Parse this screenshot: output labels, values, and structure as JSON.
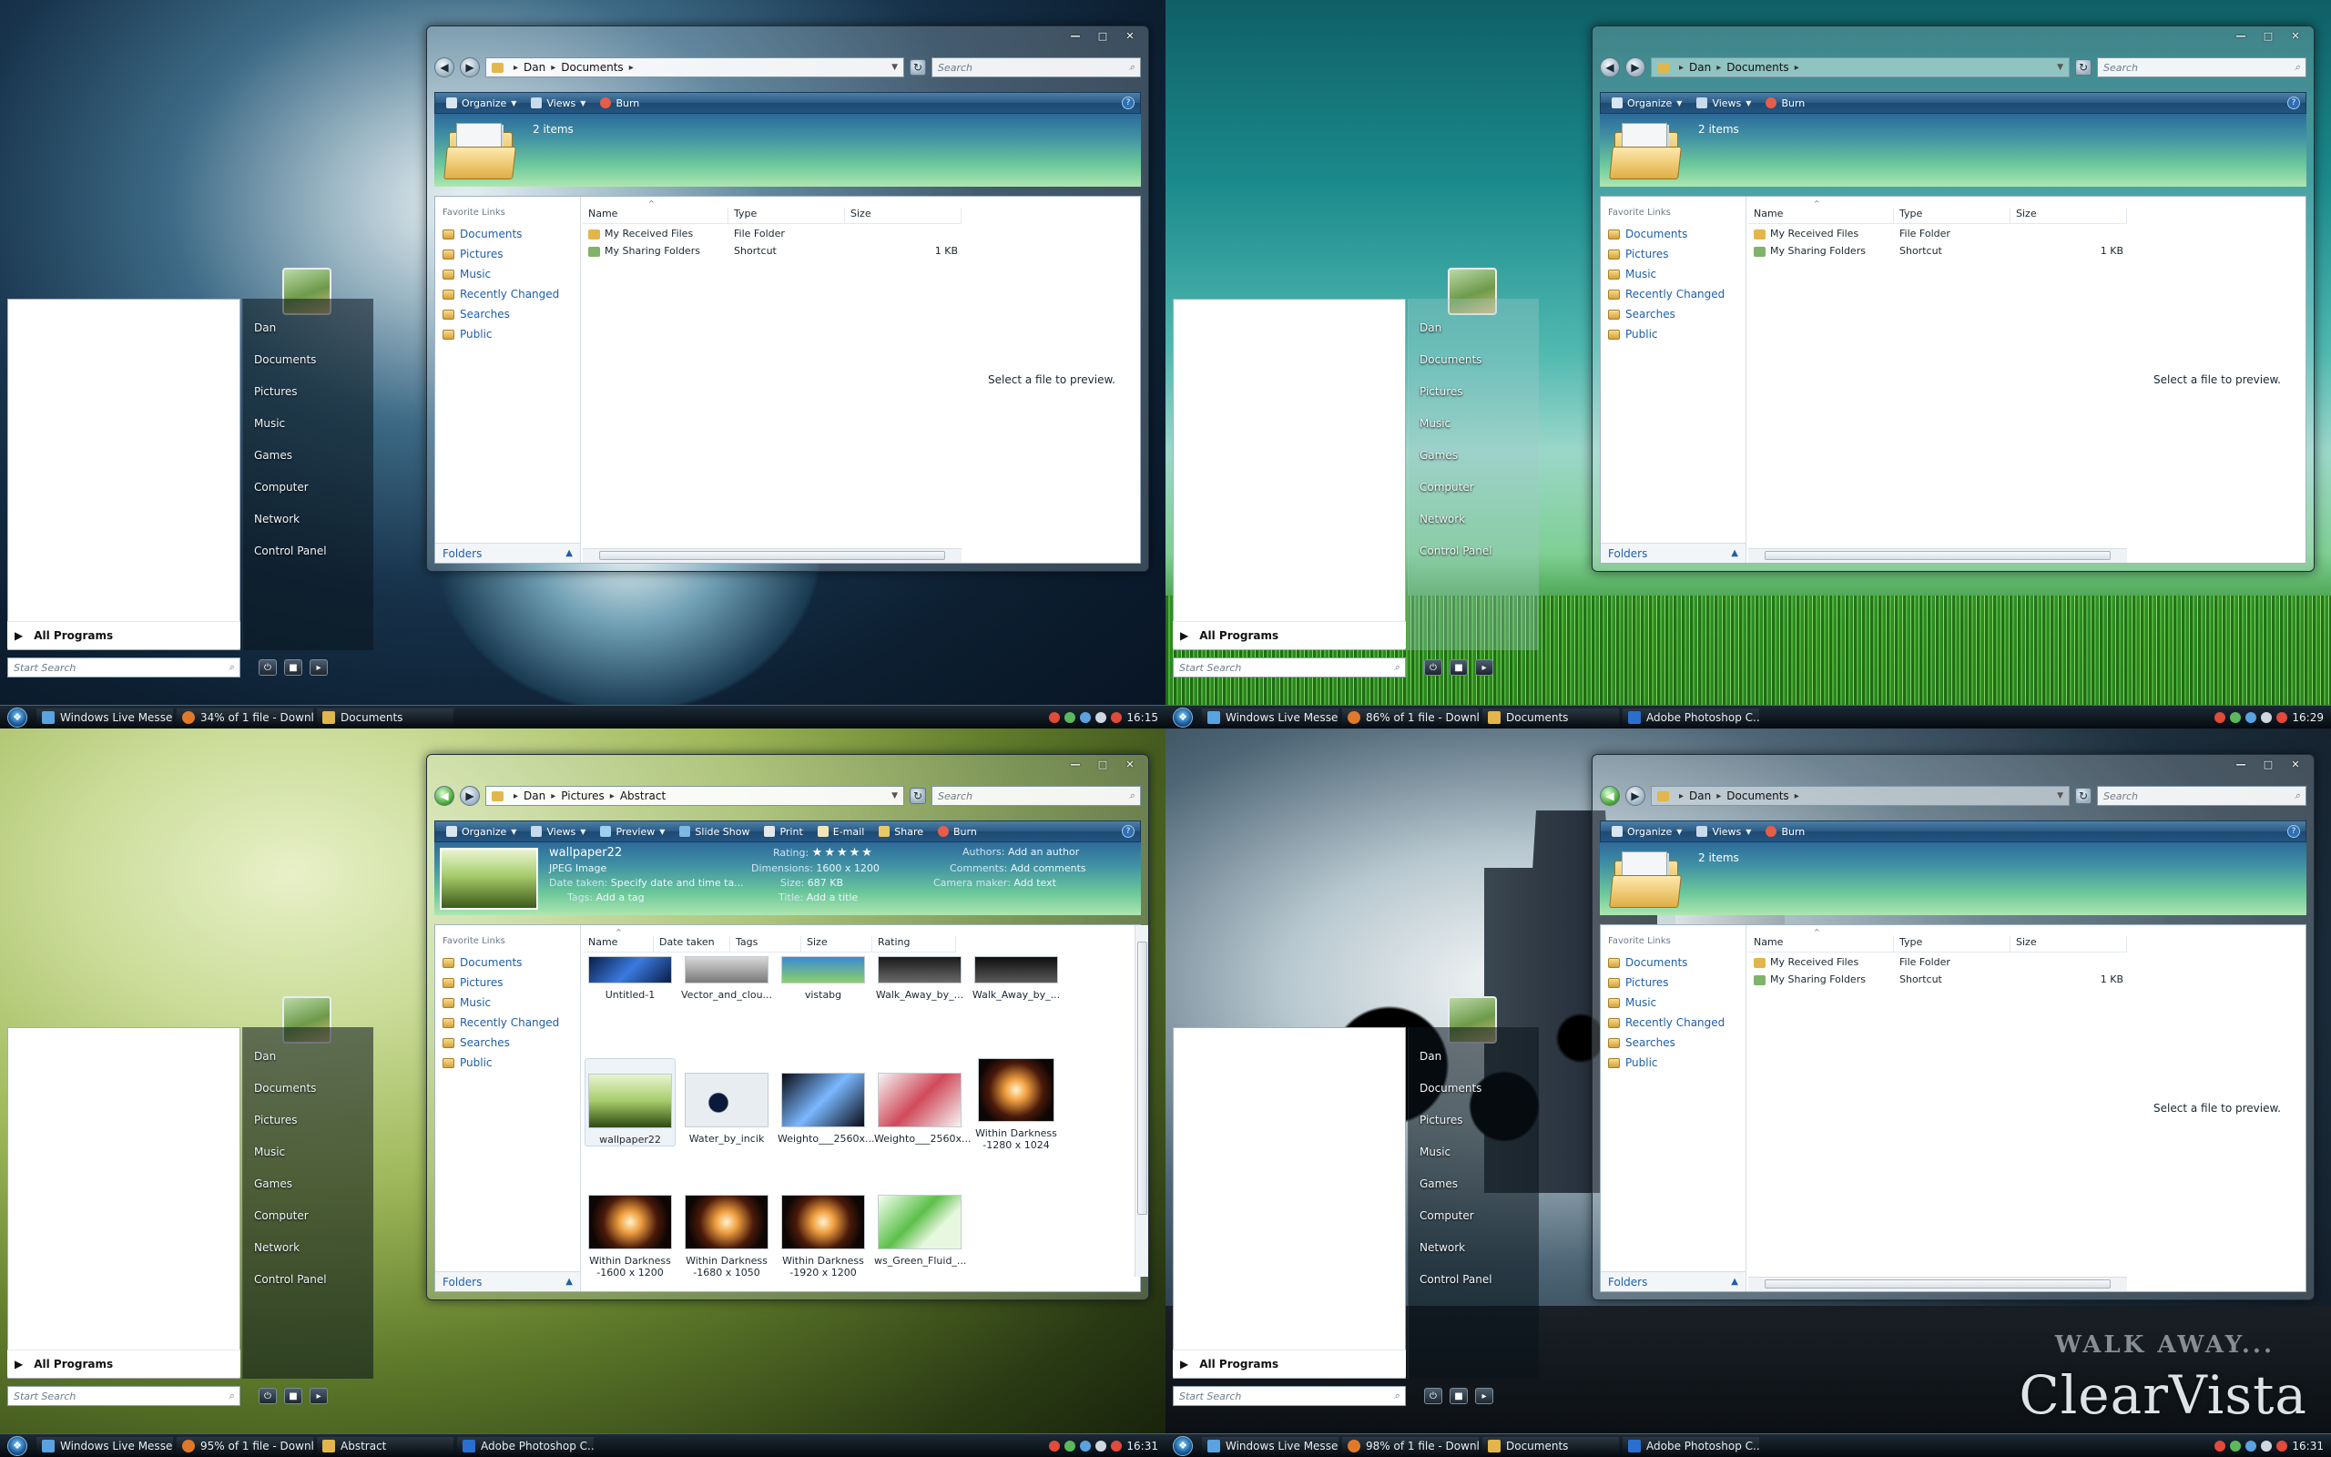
{
  "brand": "ClearVista",
  "wall_text": "WALK AWAY...",
  "colors": {
    "accent": "#2b5a84",
    "link": "#1f5fa8",
    "taskbar": "#0b141c"
  },
  "quadrants": [
    {
      "start_menu": {
        "items": [
          "Dan",
          "Documents",
          "Pictures",
          "Music",
          "Games",
          "Computer",
          "Network",
          "Control Panel"
        ],
        "all_programs": "All Programs",
        "search_placeholder": "Start Search"
      },
      "taskbar": {
        "items": [
          "Windows Live Messe...",
          "34% of 1 file - Downl...",
          "Documents"
        ],
        "clock": "16:15"
      },
      "window": {
        "path": [
          "Dan",
          "Documents"
        ],
        "search": "Search",
        "commands": [
          "Organize",
          "Views",
          "Burn"
        ],
        "count": "2 items",
        "fav_title": "Favorite Links",
        "links": [
          "Documents",
          "Pictures",
          "Music",
          "Recently Changed",
          "Searches",
          "Public"
        ],
        "folders": "Folders",
        "columns": [
          "Name",
          "Type",
          "Size"
        ],
        "rows": [
          {
            "name": "My Received Files",
            "type": "File Folder",
            "size": ""
          },
          {
            "name": "My Sharing Folders",
            "type": "Shortcut",
            "size": "1 KB"
          }
        ],
        "preview": "Select a file to preview."
      }
    },
    {
      "start_menu": {
        "items": [
          "Dan",
          "Documents",
          "Pictures",
          "Music",
          "Games",
          "Computer",
          "Network",
          "Control Panel"
        ],
        "all_programs": "All Programs",
        "search_placeholder": "Start Search"
      },
      "taskbar": {
        "items": [
          "Windows Live Messe...",
          "86% of 1 file - Downl...",
          "Documents",
          "Adobe Photoshop C..."
        ],
        "clock": "16:29"
      },
      "window": {
        "path": [
          "Dan",
          "Documents"
        ],
        "search": "Search",
        "commands": [
          "Organize",
          "Views",
          "Burn"
        ],
        "count": "2 items",
        "fav_title": "Favorite Links",
        "links": [
          "Documents",
          "Pictures",
          "Music",
          "Recently Changed",
          "Searches",
          "Public"
        ],
        "folders": "Folders",
        "columns": [
          "Name",
          "Type",
          "Size"
        ],
        "rows": [
          {
            "name": "My Received Files",
            "type": "File Folder",
            "size": ""
          },
          {
            "name": "My Sharing Folders",
            "type": "Shortcut",
            "size": "1 KB"
          }
        ],
        "preview": "Select a file to preview."
      }
    },
    {
      "start_menu": {
        "items": [
          "Dan",
          "Documents",
          "Pictures",
          "Music",
          "Games",
          "Computer",
          "Network",
          "Control Panel"
        ],
        "all_programs": "All Programs",
        "search_placeholder": "Start Search"
      },
      "taskbar": {
        "items": [
          "Windows Live Messe...",
          "95% of 1 file - Downl...",
          "Abstract",
          "Adobe Photoshop C..."
        ],
        "clock": "16:31"
      },
      "window": {
        "path": [
          "Dan",
          "Pictures",
          "Abstract"
        ],
        "search": "Search",
        "commands": [
          "Organize",
          "Views",
          "Preview",
          "Slide Show",
          "Print",
          "E-mail",
          "Share",
          "Burn"
        ],
        "fav_title": "Favorite Links",
        "links": [
          "Documents",
          "Pictures",
          "Music",
          "Recently Changed",
          "Searches",
          "Public"
        ],
        "folders": "Folders",
        "details": {
          "filename": "wallpaper22",
          "filetype": "JPEG Image",
          "date_taken_label": "Date taken:",
          "date_taken": "Specify date and time ta...",
          "tags_label": "Tags:",
          "tags": "Add a tag",
          "rating_label": "Rating:",
          "rating": 0,
          "dimensions_label": "Dimensions:",
          "dimensions": "1600 x 1200",
          "size_label": "Size:",
          "size": "687 KB",
          "title_label": "Title:",
          "title": "Add a title",
          "authors_label": "Authors:",
          "authors": "Add an author",
          "comments_label": "Comments:",
          "comments": "Add comments",
          "camera_label": "Camera maker:",
          "camera": "Add text"
        },
        "columns": [
          "Name",
          "Date taken",
          "Tags",
          "Size",
          "Rating"
        ],
        "tiles": [
          "Untitled-1",
          "Vector_and_clou...",
          "vistabg",
          "Walk_Away_by_...",
          "Walk_Away_by_...",
          "wallpaper22",
          "Water_by_incik",
          "Weighto___2560x...",
          "Weighto___2560x...",
          "Within Darkness -1280 x 1024",
          "Within Darkness -1600 x 1200",
          "Within Darkness -1680 x 1050",
          "Within Darkness -1920 x 1200",
          "ws_Green_Fluid_..."
        ]
      }
    },
    {
      "start_menu": {
        "items": [
          "Dan",
          "Documents",
          "Pictures",
          "Music",
          "Games",
          "Computer",
          "Network",
          "Control Panel"
        ],
        "all_programs": "All Programs",
        "search_placeholder": "Start Search"
      },
      "taskbar": {
        "items": [
          "Windows Live Messe...",
          "98% of 1 file - Downl...",
          "Documents",
          "Adobe Photoshop C..."
        ],
        "clock": "16:31"
      },
      "window": {
        "path": [
          "Dan",
          "Documents"
        ],
        "search": "Search",
        "commands": [
          "Organize",
          "Views",
          "Burn"
        ],
        "count": "2 items",
        "fav_title": "Favorite Links",
        "links": [
          "Documents",
          "Pictures",
          "Music",
          "Recently Changed",
          "Searches",
          "Public"
        ],
        "folders": "Folders",
        "columns": [
          "Name",
          "Type",
          "Size"
        ],
        "rows": [
          {
            "name": "My Received Files",
            "type": "File Folder",
            "size": ""
          },
          {
            "name": "My Sharing Folders",
            "type": "Shortcut",
            "size": "1 KB"
          }
        ],
        "preview": "Select a file to preview."
      }
    }
  ]
}
